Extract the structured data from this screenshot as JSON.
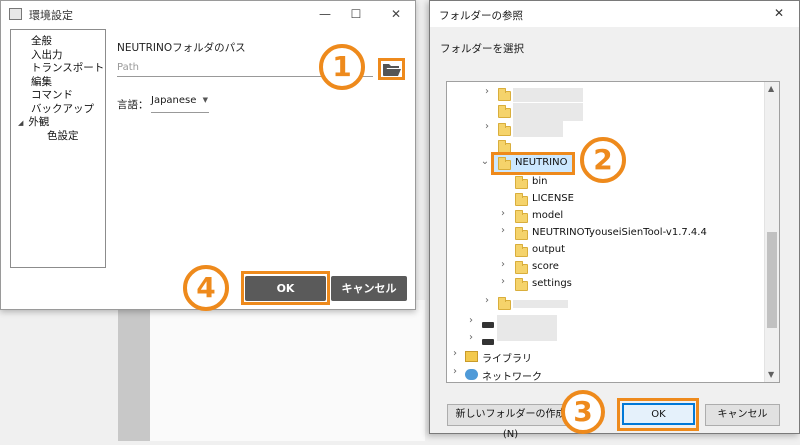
{
  "settings_window": {
    "title": "環境設定",
    "controls": {
      "minimize": "—",
      "maximize": "☐",
      "close": "✕"
    },
    "tree": [
      {
        "label": "全般",
        "indent": 0
      },
      {
        "label": "入出力",
        "indent": 0
      },
      {
        "label": "トランスポート",
        "indent": 0
      },
      {
        "label": "編集",
        "indent": 0
      },
      {
        "label": "コマンド",
        "indent": 0
      },
      {
        "label": "バックアップ",
        "indent": 0
      },
      {
        "label": "外観",
        "indent": 0,
        "expanded_glyph": "◢"
      },
      {
        "label": "色設定",
        "indent": 1
      }
    ],
    "path_label": "NEUTRINOフォルダのパス",
    "path_placeholder": "Path",
    "language_label": "言語：",
    "language_value": "Japanese",
    "ok_label": "OK",
    "cancel_label": "キャンセル"
  },
  "badges": {
    "one": "1",
    "two": "2",
    "three": "3",
    "four": "4"
  },
  "folder_dialog": {
    "title": "フォルダーの参照",
    "close": "✕",
    "prompt": "フォルダーを選択",
    "selected_folder": "NEUTRINO",
    "children": [
      "bin",
      "LICENSE",
      "model",
      "NEUTRINOTyouseiSienTool-v1.7.4.4",
      "output",
      "score",
      "settings"
    ],
    "library": "ライブラリ",
    "network": "ネットワーク",
    "new_folder_label": "新しいフォルダーの作成(N)",
    "ok_label": "OK",
    "cancel_label": "キャンセル"
  },
  "colors": {
    "accent": "#ee8a1c",
    "dark_button": "#5a5a5a",
    "selection": "#cce8ff"
  }
}
